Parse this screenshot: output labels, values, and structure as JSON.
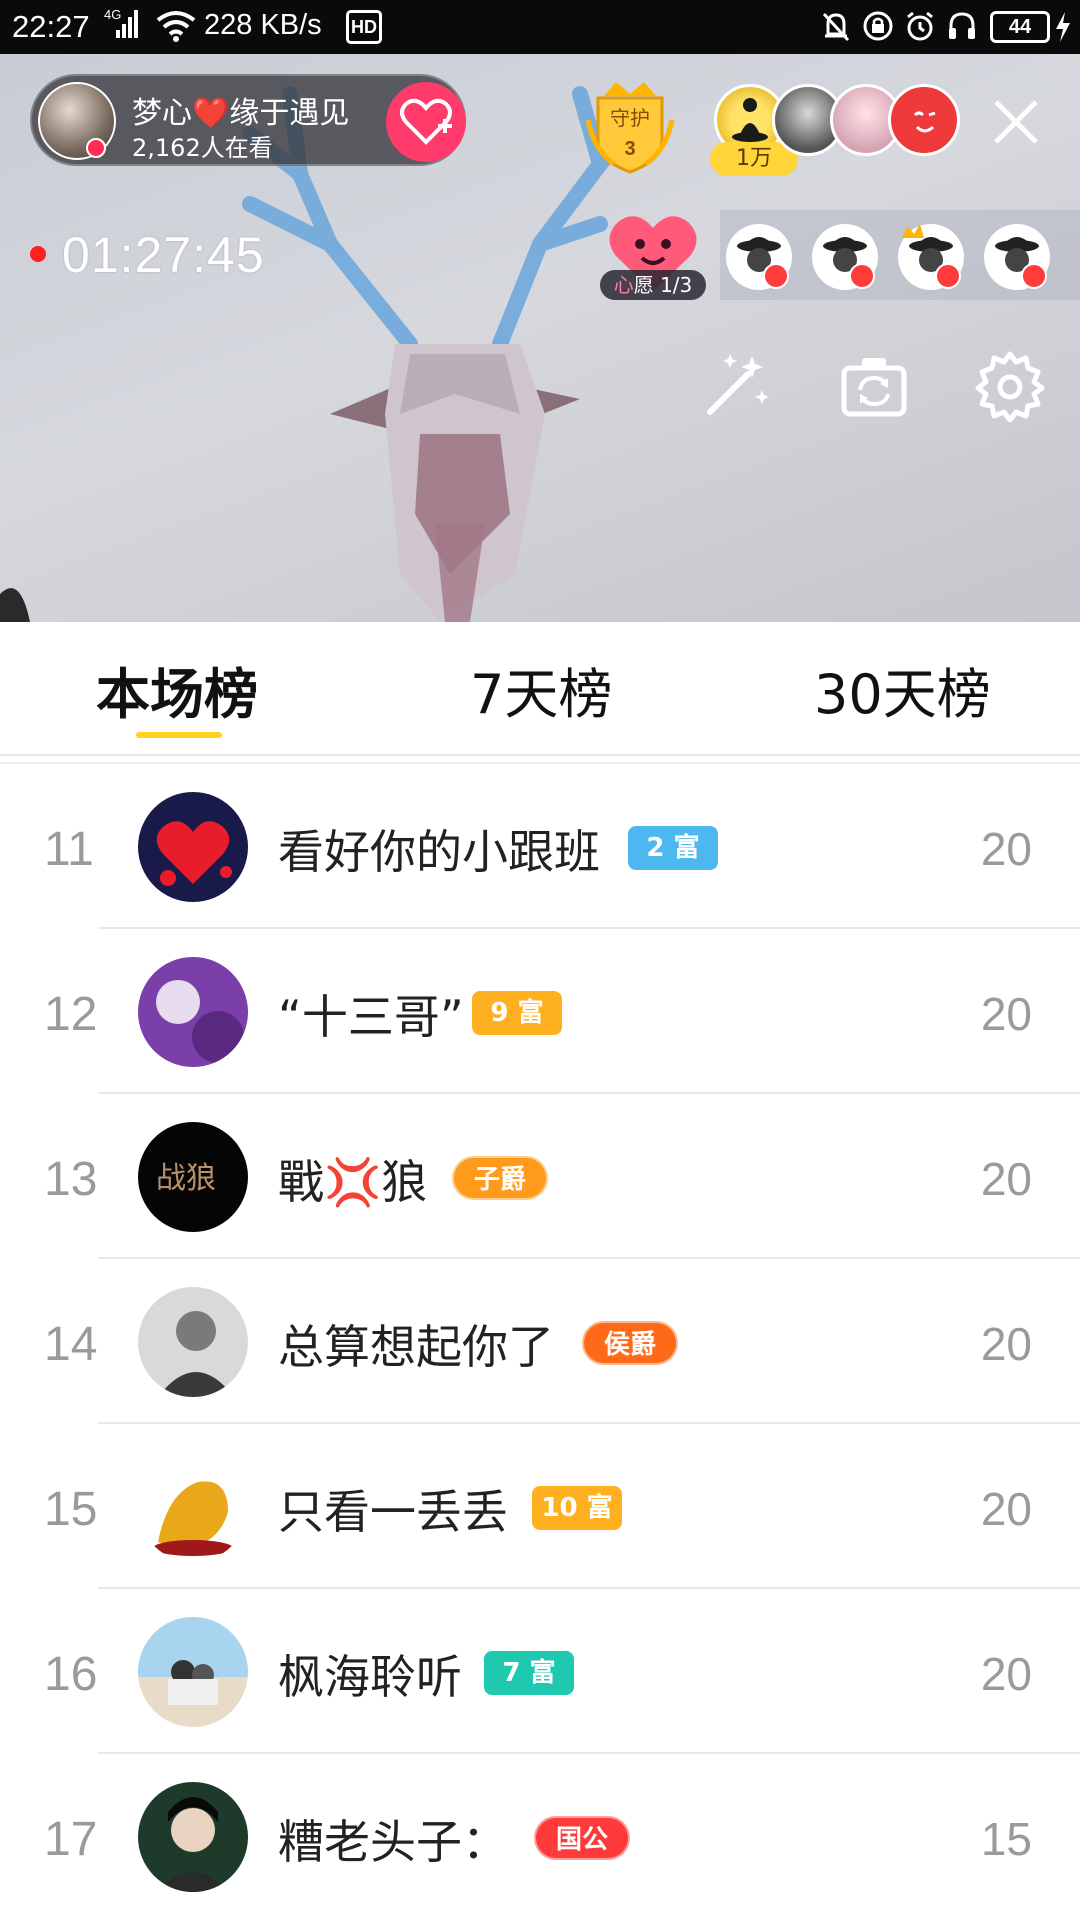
{
  "status_bar": {
    "time": "22:27",
    "network": "4G",
    "speed": "228 KB/s",
    "hd": "HD",
    "battery": "44"
  },
  "live": {
    "host_name": "梦心❤️缘于遇见",
    "viewers": "2,162人在看",
    "guard_label": "守护",
    "guard_count": "3",
    "rank1_tag": "1万",
    "elapsed": "01:27:45",
    "wish_label_prefix": "心",
    "wish_label": "愿 1/3"
  },
  "tabs": [
    {
      "label": "本场榜",
      "active": true
    },
    {
      "label": "7天榜",
      "active": false
    },
    {
      "label": "30天榜",
      "active": false
    }
  ],
  "rows": [
    {
      "rank": "11",
      "name": "看好你的小跟班",
      "badge": "2 富",
      "badge_color": "#4db8f0",
      "score": "20"
    },
    {
      "rank": "12",
      "name": "“十三哥”",
      "badge": "9 富",
      "badge_color": "#ffb020",
      "score": "20"
    },
    {
      "rank": "13",
      "name": "戰💢狼",
      "badge": "子爵",
      "badge_color": "#ff9a1a",
      "score": "20"
    },
    {
      "rank": "14",
      "name": "总算想起你了",
      "badge": "侯爵",
      "badge_color": "#ff6a1a",
      "score": "20"
    },
    {
      "rank": "15",
      "name": "只看一丢丢",
      "badge": "10 富",
      "badge_color": "#ffb020",
      "score": "20"
    },
    {
      "rank": "16",
      "name": "枫海聆听",
      "badge": "7 富",
      "badge_color": "#1ec9b0",
      "score": "20"
    },
    {
      "rank": "17",
      "name": "糟老头子：",
      "badge": "国公",
      "badge_color": "#ff3a3a",
      "score": "15"
    }
  ],
  "icons": {
    "close": "close-icon",
    "follow": "heart-plus-icon",
    "beauty": "magic-wand-icon",
    "camera_flip": "camera-flip-icon",
    "settings": "gear-icon"
  },
  "colors": {
    "accent": "#ffd21e",
    "follow_pink": "#ff3b6b",
    "rank_gray": "#9a9a9a"
  }
}
